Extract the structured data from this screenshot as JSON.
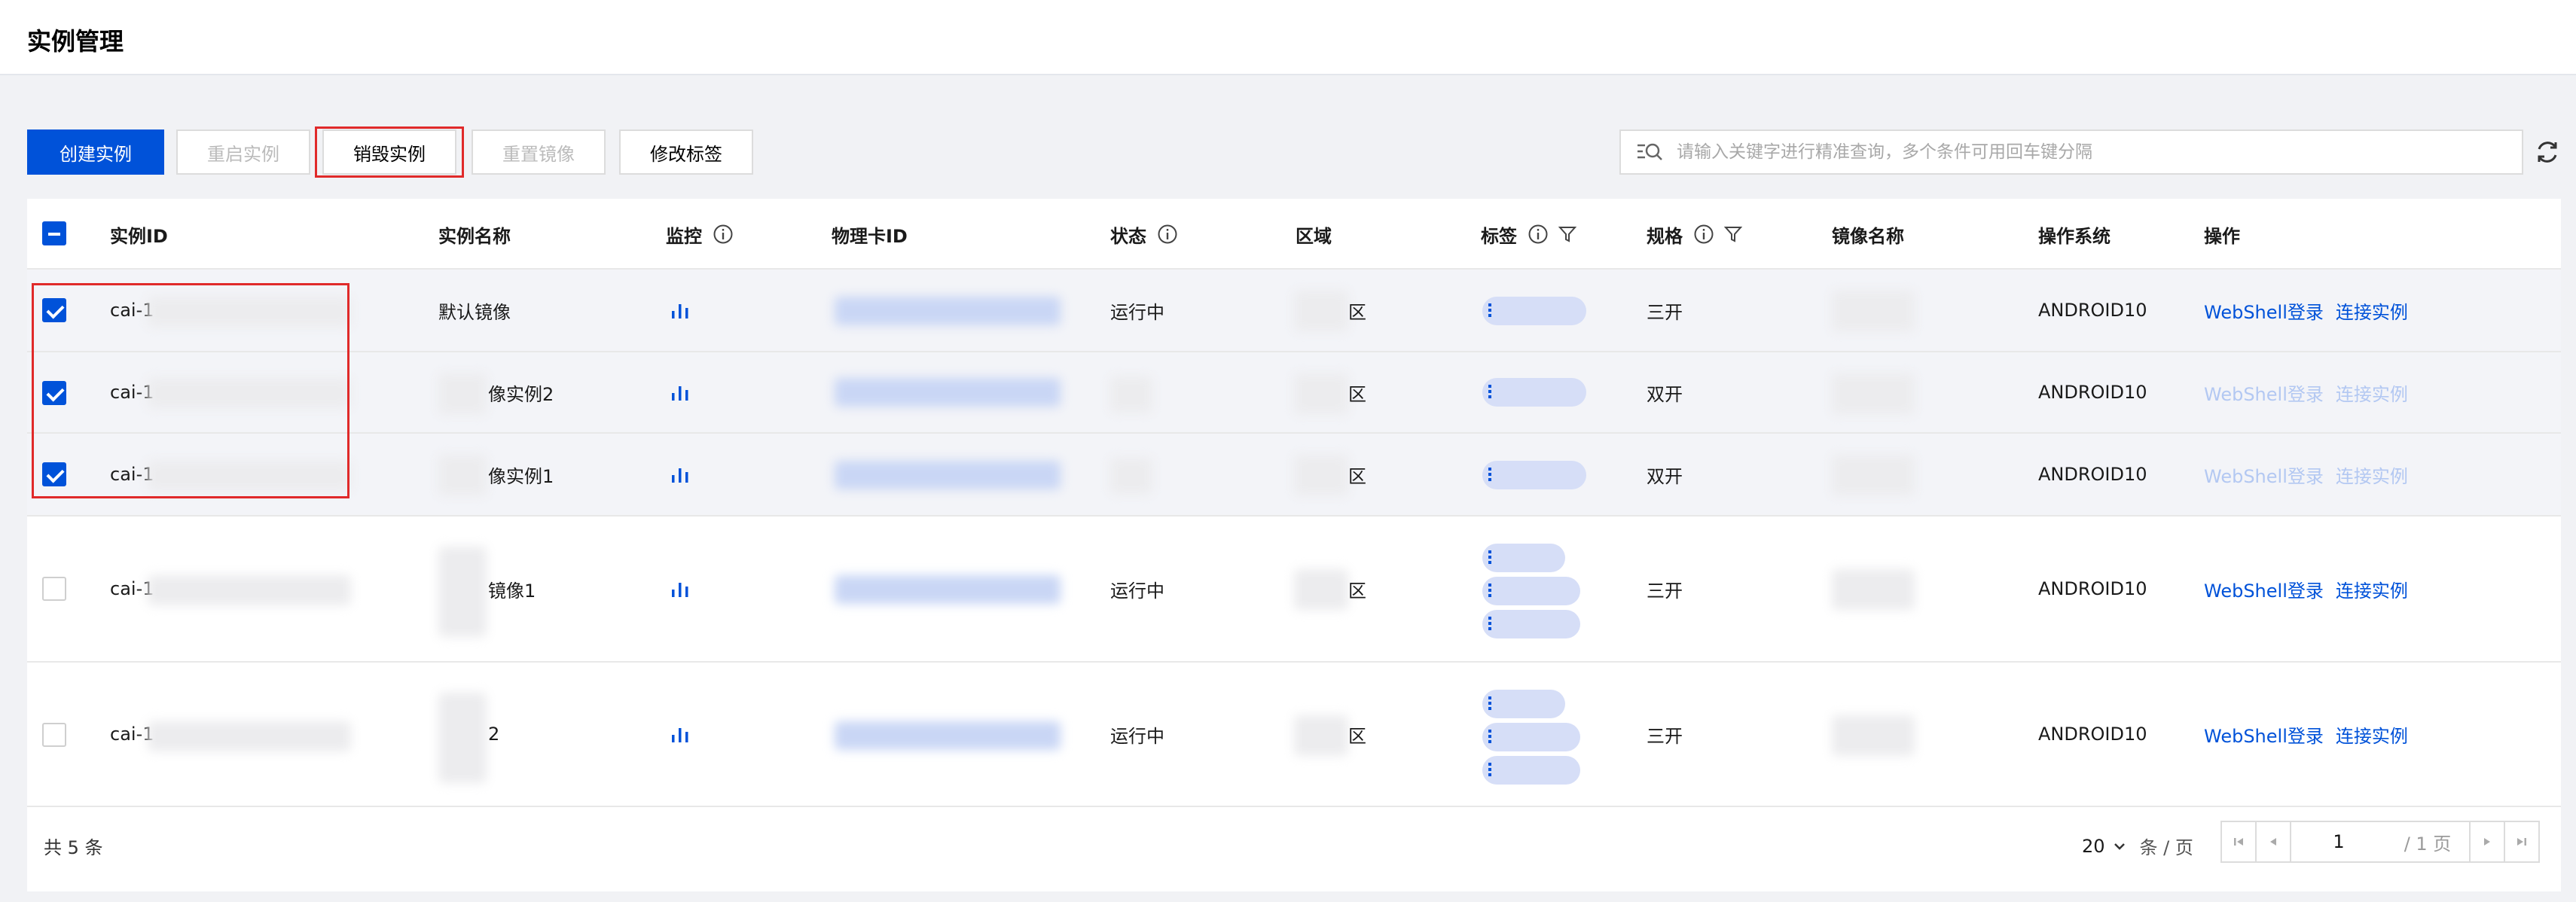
{
  "header": {
    "title": "实例管理"
  },
  "toolbar": {
    "create": "创建实例",
    "restart": "重启实例",
    "destroy": "销毁实例",
    "reset_image": "重置镜像",
    "edit_tags": "修改标签"
  },
  "search": {
    "placeholder": "请输入关键字进行精准查询，多个条件可用回车键分隔"
  },
  "columns": {
    "instance_id": "实例ID",
    "instance_name": "实例名称",
    "monitor": "监控",
    "card_id": "物理卡ID",
    "status": "状态",
    "region": "区域",
    "tags": "标签",
    "spec": "规格",
    "image_name": "镜像名称",
    "os": "操作系统",
    "action": "操作"
  },
  "rows": [
    {
      "id_prefix": "cai-1",
      "name": "默认镜像",
      "status": "运行中",
      "region_suffix": "区",
      "spec": "三开",
      "os": "ANDROID10",
      "webshell": "WebShell登录",
      "connect": "连接实例",
      "checked": true,
      "faded": false
    },
    {
      "id_prefix": "cai-1",
      "name": "像实例2",
      "status": "",
      "region_suffix": "区",
      "spec": "双开",
      "os": "ANDROID10",
      "webshell": "WebShell登录",
      "connect": "连接实例",
      "checked": true,
      "faded": true
    },
    {
      "id_prefix": "cai-1",
      "name": "像实例1",
      "status": "",
      "region_suffix": "区",
      "spec": "双开",
      "os": "ANDROID10",
      "webshell": "WebShell登录",
      "connect": "连接实例",
      "checked": true,
      "faded": true
    },
    {
      "id_prefix": "cai-1",
      "name": "镜像1",
      "status": "运行中",
      "region_suffix": "区",
      "spec": "三开",
      "os": "ANDROID10",
      "webshell": "WebShell登录",
      "connect": "连接实例",
      "checked": false,
      "faded": false
    },
    {
      "id_prefix": "cai-1",
      "name": "2",
      "status": "运行中",
      "region_suffix": "区",
      "spec": "三开",
      "os": "ANDROID10",
      "webshell": "WebShell登录",
      "connect": "连接实例",
      "checked": false,
      "faded": false
    }
  ],
  "pagination": {
    "total": "共 5 条",
    "page_size": "20",
    "per_page": "条 / 页",
    "current_page": "1",
    "total_pages": "/ 1 页"
  },
  "colors": {
    "primary": "#0052d9",
    "highlight": "#e02a2a",
    "link_disabled": "#b3c8f2"
  },
  "icons": [
    "search-icon",
    "refresh-icon",
    "info-icon",
    "filter-icon",
    "bar-chart-icon",
    "chevron-down-icon",
    "first-page-icon",
    "prev-page-icon",
    "next-page-icon",
    "last-page-icon"
  ]
}
